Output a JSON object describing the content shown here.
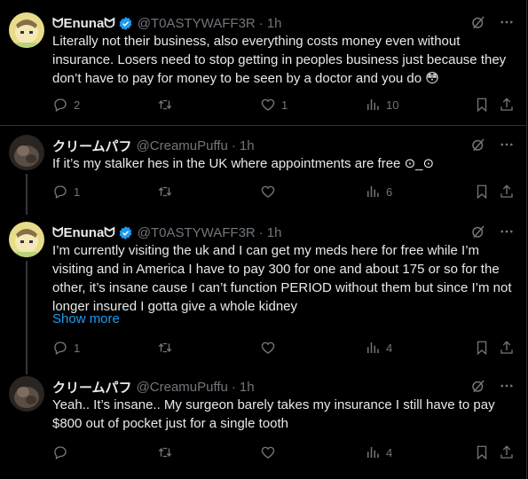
{
  "tweets": [
    {
      "name": "ᗢEnunaᗢ",
      "verified": true,
      "handle": "@T0ASTYWAFF3R",
      "time": "1h",
      "text": "Literally not their business, also everything costs money even without insurance. Losers need to stop getting in peoples business just because they don’t have to pay for money to be seen by a doctor and you do 😳",
      "replies": "2",
      "retweets": "",
      "likes": "1",
      "views": "10"
    },
    {
      "name": "クリームパフ",
      "verified": false,
      "handle": "@CreamuPuffu",
      "time": "1h",
      "text": "If it’s my stalker hes in the UK where appointments are free ⊙_⊙",
      "replies": "1",
      "retweets": "",
      "likes": "",
      "views": "6"
    },
    {
      "name": "ᗢEnunaᗢ",
      "verified": true,
      "handle": "@T0ASTYWAFF3R",
      "time": "1h",
      "text": "I’m currently visiting the uk and I can get my meds here for free while I’m visiting and in America I have to pay 300 for one and about 175 or so for the other, it’s insane cause I can’t function PERIOD without them but since I’m not longer insured I gotta give a whole kidney",
      "show_more": "Show more",
      "replies": "1",
      "retweets": "",
      "likes": "",
      "views": "4"
    },
    {
      "name": "クリームパフ",
      "verified": false,
      "handle": "@CreamuPuffu",
      "time": "1h",
      "text": "Yeah.. It’s insane.. My surgeon barely takes my insurance I still have to pay $800 out of pocket just for a single tooth",
      "replies": "",
      "retweets": "",
      "likes": "",
      "views": "4"
    }
  ],
  "separator": "·",
  "colors": {
    "background": "#000000",
    "text": "#e7e9ea",
    "muted": "#71767b",
    "accent": "#1d9bf0",
    "divider": "#2f3336"
  },
  "icons": [
    "verified-badge-icon",
    "grok-icon",
    "more-icon",
    "reply-icon",
    "retweet-icon",
    "like-icon",
    "views-icon",
    "bookmark-icon",
    "share-icon"
  ]
}
